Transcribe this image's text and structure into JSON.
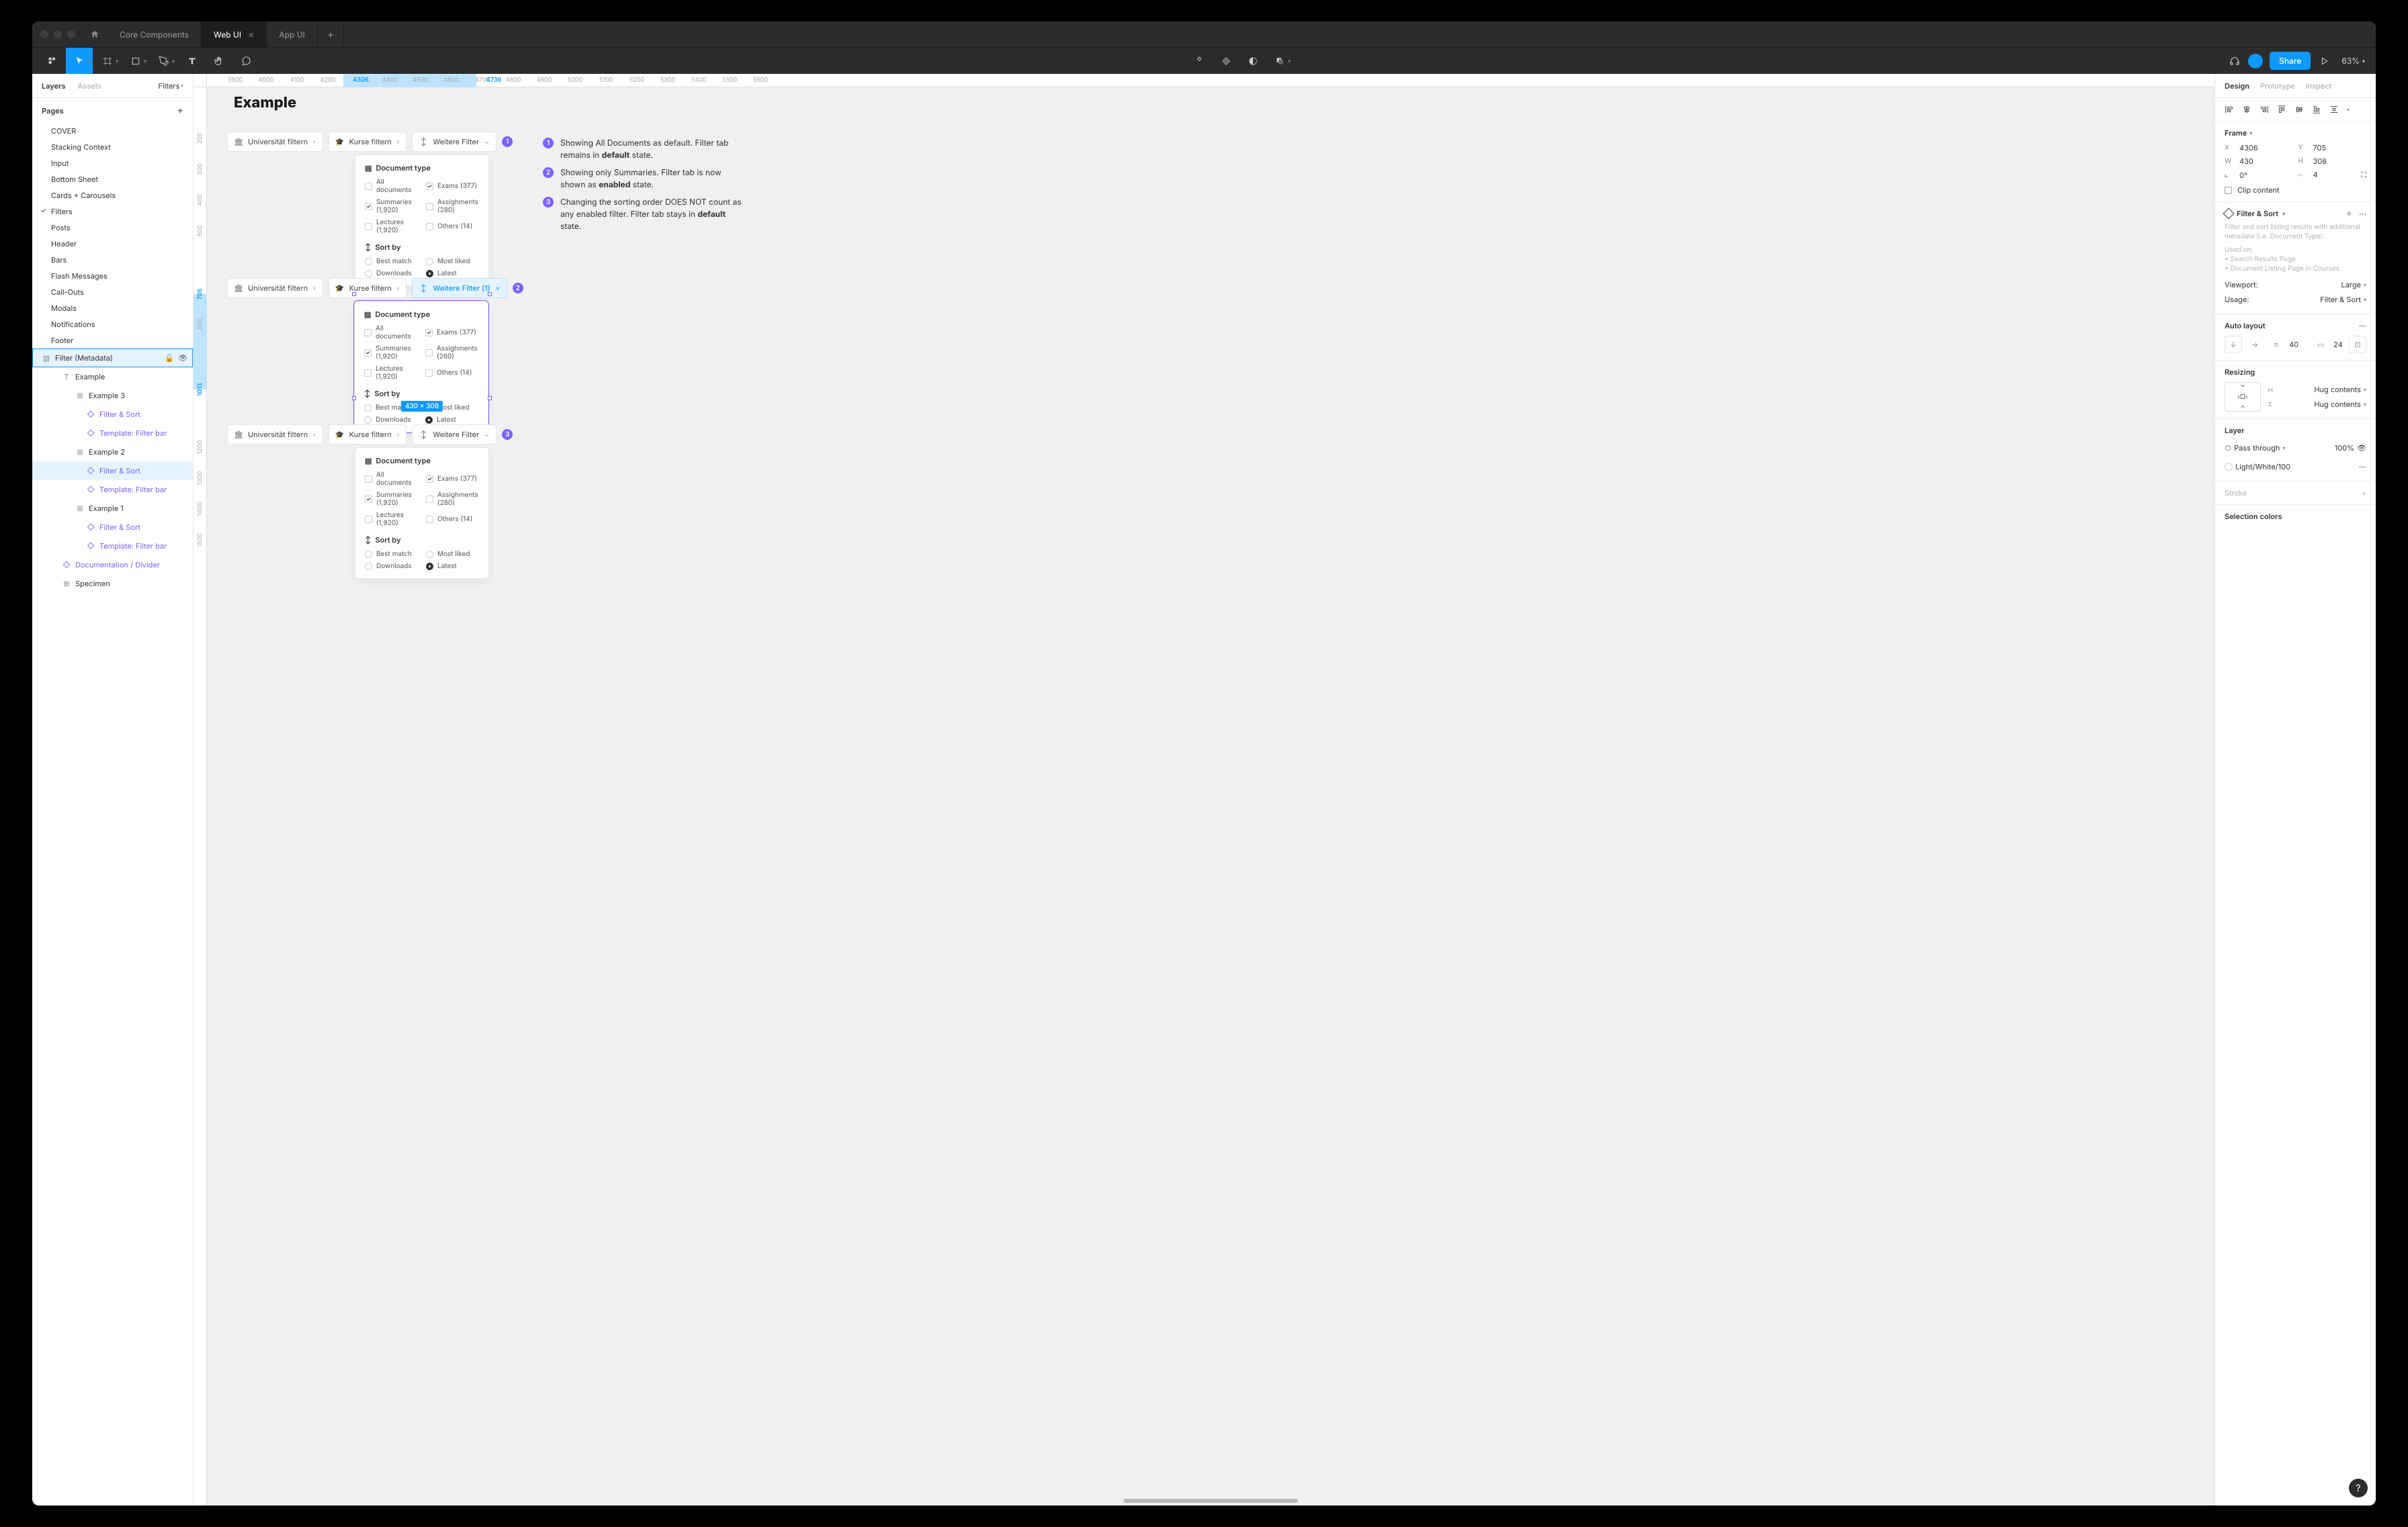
{
  "titlebar": {
    "tabs": [
      {
        "label": "Core Components",
        "active": false
      },
      {
        "label": "Web UI",
        "active": true
      },
      {
        "label": "App UI",
        "active": false
      }
    ]
  },
  "toolbar": {
    "share": "Share",
    "zoom": "63%"
  },
  "left": {
    "tabs": {
      "layers": "Layers",
      "assets": "Assets",
      "filter": "Filters"
    },
    "pages_label": "Pages",
    "pages": [
      "COVER",
      "Stacking Context",
      "Input",
      "Bottom Sheet",
      "Cards + Carousels",
      "Filters",
      "Posts",
      "Header",
      "Bars",
      "Flash Messages",
      "Call-Outs",
      "Modals",
      "Notifications",
      "Footer"
    ],
    "selected_page": "Filters",
    "layers": {
      "root": "Filter (Metadata)",
      "example": "Example",
      "example3": "Example 3",
      "filter_sort": "Filter & Sort",
      "template": "Template: Filter bar",
      "example2": "Example 2",
      "example1": "Example 1",
      "doc_div": "Documentation / Divider",
      "specimen": "Specimen"
    }
  },
  "canvas": {
    "title": "Example",
    "ruler_x": [
      "3900",
      "4000",
      "4100",
      "4200",
      "4306",
      "4400",
      "4500",
      "4600",
      "4700",
      "4736",
      "4800",
      "4900",
      "5000",
      "5100",
      "5200",
      "5300",
      "5400",
      "5500",
      "5600"
    ],
    "ruler_y": [
      "200",
      "300",
      "400",
      "500",
      "705",
      "800",
      "1013",
      "1200",
      "1300",
      "1400",
      "1500"
    ],
    "pills": {
      "univ": "Universität filtern",
      "kurse": "Kurse filtern",
      "weitere": "Weitere Filter",
      "weitere_active": "Weitere Filter (1)"
    },
    "dropdown": {
      "doc_type": "Document type",
      "all_docs": "All documents",
      "exams": "Exams (377)",
      "summaries": "Summaries (1,920)",
      "assignments": "Assighments (280)",
      "lectures": "Lectures (1,920)",
      "others": "Others (14)",
      "sort_by": "Sort by",
      "best_match": "Best match",
      "most_liked": "Most liked",
      "downloads": "Downloads",
      "latest": "Latest"
    },
    "sel_dim": "430 × 308",
    "notes": [
      {
        "n": "1",
        "text_a": "Showing All Documents as default. Filter tab remains in ",
        "bold": "default",
        "text_b": " state."
      },
      {
        "n": "2",
        "text_a": "Showing only Summaries. Filter tab is now shown as ",
        "bold": "enabled",
        "text_b": " state."
      },
      {
        "n": "3",
        "text_a": "Changing the sorting order DOES NOT count as any enabled filter. Filter tab stays in ",
        "bold": "default",
        "text_b": " state."
      }
    ]
  },
  "right": {
    "tabs": {
      "design": "Design",
      "prototype": "Prototype",
      "inspect": "Inspect"
    },
    "frame": {
      "label": "Frame",
      "x": "4306",
      "y": "705",
      "w": "430",
      "h": "308",
      "rot": "0°",
      "rad": "4",
      "clip": "Clip content"
    },
    "component": {
      "name": "Filter & Sort",
      "desc": "Filter and sort listing results with additional metadata (i.e. Document Type).",
      "used": "Used on:",
      "u1": "Search Results Page",
      "u2": "Document Listing Page in Courses.",
      "viewport_k": "Viewport:",
      "viewport_v": "Large",
      "usage_k": "Usage:",
      "usage_v": "Filter & Sort"
    },
    "autolayout": {
      "label": "Auto layout",
      "gap": "40",
      "pad": "24"
    },
    "resizing": {
      "label": "Resizing",
      "hug": "Hug contents"
    },
    "layer": {
      "label": "Layer",
      "mode": "Pass through",
      "opacity": "100%",
      "fill": "Light/White/100"
    },
    "stroke": "Stroke",
    "selcolors": "Selection colors"
  }
}
